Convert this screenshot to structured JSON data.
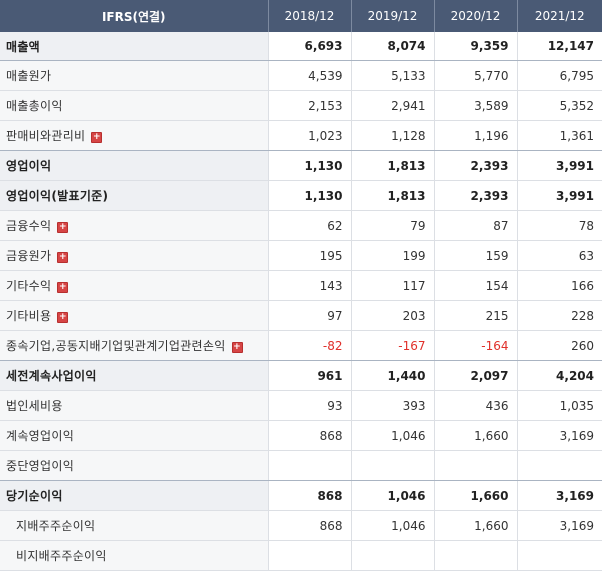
{
  "header": {
    "label": "IFRS(연결)",
    "periods": [
      "2018/12",
      "2019/12",
      "2020/12",
      "2021/12"
    ]
  },
  "rows": [
    {
      "label": "매출액",
      "values": [
        "6,693",
        "8,074",
        "9,359",
        "12,147"
      ],
      "bold": true,
      "expandable": false,
      "indent": false,
      "sep": true
    },
    {
      "label": "매출원가",
      "values": [
        "4,539",
        "5,133",
        "5,770",
        "6,795"
      ],
      "bold": false,
      "expandable": false,
      "indent": false,
      "sep": false
    },
    {
      "label": "매출총이익",
      "values": [
        "2,153",
        "2,941",
        "3,589",
        "5,352"
      ],
      "bold": false,
      "expandable": false,
      "indent": false,
      "sep": false
    },
    {
      "label": "판매비와관리비",
      "values": [
        "1,023",
        "1,128",
        "1,196",
        "1,361"
      ],
      "bold": false,
      "expandable": true,
      "indent": false,
      "sep": true
    },
    {
      "label": "영업이익",
      "values": [
        "1,130",
        "1,813",
        "2,393",
        "3,991"
      ],
      "bold": true,
      "expandable": false,
      "indent": false,
      "sep": false
    },
    {
      "label": "영업이익(발표기준)",
      "values": [
        "1,130",
        "1,813",
        "2,393",
        "3,991"
      ],
      "bold": true,
      "expandable": false,
      "indent": false,
      "sep": false
    },
    {
      "label": "금융수익",
      "values": [
        "62",
        "79",
        "87",
        "78"
      ],
      "bold": false,
      "expandable": true,
      "indent": false,
      "sep": false
    },
    {
      "label": "금융원가",
      "values": [
        "195",
        "199",
        "159",
        "63"
      ],
      "bold": false,
      "expandable": true,
      "indent": false,
      "sep": false
    },
    {
      "label": "기타수익",
      "values": [
        "143",
        "117",
        "154",
        "166"
      ],
      "bold": false,
      "expandable": true,
      "indent": false,
      "sep": false
    },
    {
      "label": "기타비용",
      "values": [
        "97",
        "203",
        "215",
        "228"
      ],
      "bold": false,
      "expandable": true,
      "indent": false,
      "sep": false
    },
    {
      "label": "종속기업,공동지배기업및관계기업관련손익",
      "values": [
        "-82",
        "-167",
        "-164",
        "260"
      ],
      "bold": false,
      "expandable": true,
      "indent": false,
      "sep": true
    },
    {
      "label": "세전계속사업이익",
      "values": [
        "961",
        "1,440",
        "2,097",
        "4,204"
      ],
      "bold": true,
      "expandable": false,
      "indent": false,
      "sep": false
    },
    {
      "label": "법인세비용",
      "values": [
        "93",
        "393",
        "436",
        "1,035"
      ],
      "bold": false,
      "expandable": false,
      "indent": false,
      "sep": false
    },
    {
      "label": "계속영업이익",
      "values": [
        "868",
        "1,046",
        "1,660",
        "3,169"
      ],
      "bold": false,
      "expandable": false,
      "indent": false,
      "sep": false
    },
    {
      "label": "중단영업이익",
      "values": [
        "",
        "",
        "",
        ""
      ],
      "bold": false,
      "expandable": false,
      "indent": false,
      "sep": true
    },
    {
      "label": "당기순이익",
      "values": [
        "868",
        "1,046",
        "1,660",
        "3,169"
      ],
      "bold": true,
      "expandable": false,
      "indent": false,
      "sep": false
    },
    {
      "label": "지배주주순이익",
      "values": [
        "868",
        "1,046",
        "1,660",
        "3,169"
      ],
      "bold": false,
      "expandable": false,
      "indent": true,
      "sep": false
    },
    {
      "label": "비지배주주순이익",
      "values": [
        "",
        "",
        "",
        ""
      ],
      "bold": false,
      "expandable": false,
      "indent": true,
      "sep": false
    }
  ],
  "expand_icon_glyph": "+",
  "icons": {
    "expand": "plus-square-icon"
  },
  "colors": {
    "header_bg": "#4a5a75",
    "negative": "#e0302a",
    "expand_icon": "#d64545"
  }
}
